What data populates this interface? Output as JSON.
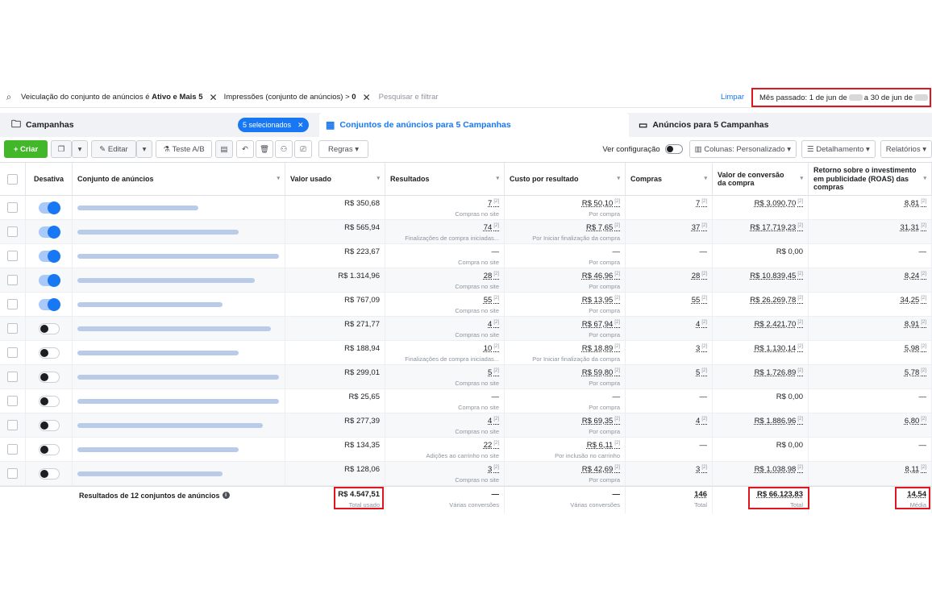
{
  "filter_bar": {
    "chip1_prefix": "Veiculação do conjunto de anúncios é",
    "chip1_value": "Ativo e Mais 5",
    "chip2_prefix": "Impressões (conjunto de anúncios) >",
    "chip2_value": "0",
    "search_placeholder": "Pesquisar e filtrar",
    "clear_label": "Limpar",
    "date_part1": "Mês passado: 1 de jun de",
    "date_part2": "a 30 de jun de"
  },
  "tabs": {
    "campaigns": "Campanhas",
    "selected_pill": "5 selecionados",
    "adsets": "Conjuntos de anúncios para 5 Campanhas",
    "ads": "Anúncios para 5 Campanhas"
  },
  "toolbar": {
    "create": "Criar",
    "edit": "Editar",
    "ab_test": "Teste A/B",
    "rules": "Regras",
    "view_config": "Ver configuração",
    "columns": "Colunas: Personalizado",
    "breakdown": "Detalhamento",
    "reports": "Relatórios"
  },
  "columns": {
    "toggle": "Desativa",
    "name": "Conjunto de anúncios",
    "spend": "Valor usado",
    "results": "Resultados",
    "cost_per_result": "Custo por resultado",
    "purchases": "Compras",
    "conv_value": "Valor de conversão da compra",
    "roas": "Retorno sobre o investimento em publicidade (ROAS) das compras"
  },
  "rows": [
    {
      "on": true,
      "spend": "R$ 350,68",
      "result": "7",
      "result_sub": "Compras no site",
      "cpr": "R$ 50,10",
      "cpr_sub": "Por compra",
      "purchases": "7",
      "conv": "R$ 3.090,70",
      "roas": "8,81"
    },
    {
      "on": true,
      "spend": "R$ 565,94",
      "result": "74",
      "result_sub": "Finalizações de compra iniciadas...",
      "cpr": "R$ 7,65",
      "cpr_sub": "Por Iniciar finalização da compra",
      "purchases": "37",
      "conv": "R$ 17.719,23",
      "roas": "31,31"
    },
    {
      "on": true,
      "spend": "R$ 223,67",
      "result": "—",
      "result_sub": "Compra no site",
      "cpr": "—",
      "cpr_sub": "Por compra",
      "purchases": "—",
      "conv": "R$ 0,00",
      "roas": "—"
    },
    {
      "on": true,
      "spend": "R$ 1.314,96",
      "result": "28",
      "result_sub": "Compras no site",
      "cpr": "R$ 46,96",
      "cpr_sub": "Por compra",
      "purchases": "28",
      "conv": "R$ 10.839,45",
      "roas": "8,24"
    },
    {
      "on": true,
      "spend": "R$ 767,09",
      "result": "55",
      "result_sub": "Compras no site",
      "cpr": "R$ 13,95",
      "cpr_sub": "Por compra",
      "purchases": "55",
      "conv": "R$ 26.269,78",
      "roas": "34,25"
    },
    {
      "on": false,
      "spend": "R$ 271,77",
      "result": "4",
      "result_sub": "Compras no site",
      "cpr": "R$ 67,94",
      "cpr_sub": "Por compra",
      "purchases": "4",
      "conv": "R$ 2.421,70",
      "roas": "8,91"
    },
    {
      "on": false,
      "spend": "R$ 188,94",
      "result": "10",
      "result_sub": "Finalizações de compra iniciadas...",
      "cpr": "R$ 18,89",
      "cpr_sub": "Por Iniciar finalização da compra",
      "purchases": "3",
      "conv": "R$ 1.130,14",
      "roas": "5,98"
    },
    {
      "on": false,
      "spend": "R$ 299,01",
      "result": "5",
      "result_sub": "Compras no site",
      "cpr": "R$ 59,80",
      "cpr_sub": "Por compra",
      "purchases": "5",
      "conv": "R$ 1.726,89",
      "roas": "5,78"
    },
    {
      "on": false,
      "spend": "R$ 25,65",
      "result": "—",
      "result_sub": "Compra no site",
      "cpr": "—",
      "cpr_sub": "Por compra",
      "purchases": "—",
      "conv": "R$ 0,00",
      "roas": "—"
    },
    {
      "on": false,
      "spend": "R$ 277,39",
      "result": "4",
      "result_sub": "Compras no site",
      "cpr": "R$ 69,35",
      "cpr_sub": "Por compra",
      "purchases": "4",
      "conv": "R$ 1.886,96",
      "roas": "6,80"
    },
    {
      "on": false,
      "spend": "R$ 134,35",
      "result": "22",
      "result_sub": "Adições ao carrinho no site",
      "cpr": "R$ 6,11",
      "cpr_sub": "Por inclusão no carrinho",
      "purchases": "—",
      "conv": "R$ 0,00",
      "roas": "—"
    },
    {
      "on": false,
      "spend": "R$ 128,06",
      "result": "3",
      "result_sub": "Compras no site",
      "cpr": "R$ 42,69",
      "cpr_sub": "Por compra",
      "purchases": "3",
      "conv": "R$ 1.038,98",
      "roas": "8,11"
    }
  ],
  "footer": {
    "label": "Resultados de 12 conjuntos de anúncios",
    "spend": "R$ 4.547,51",
    "spend_sub": "Total usado",
    "results": "—",
    "results_sub": "Várias conversões",
    "cpr": "—",
    "cpr_sub": "Várias conversões",
    "purchases": "146",
    "purchases_sub": "Total",
    "conv": "R$ 66.123,83",
    "conv_sub": "Total",
    "roas": "14,54",
    "roas_sub": "Média"
  },
  "colors": {
    "accent": "#1877f2",
    "create": "#42b72a",
    "highlight": "#e0161e"
  }
}
